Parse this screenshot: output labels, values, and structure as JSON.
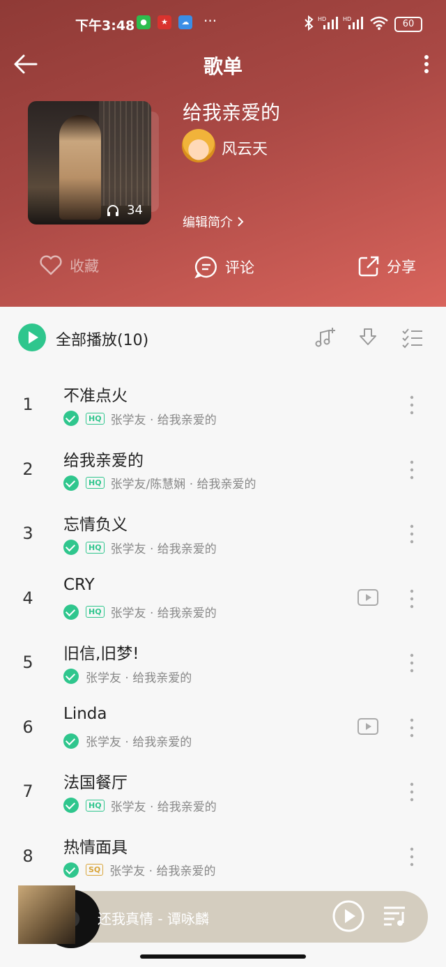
{
  "status_bar": {
    "time": "下午3:48",
    "battery": "60",
    "dots": "···"
  },
  "nav": {
    "title": "歌单"
  },
  "playlist": {
    "title": "给我亲爱的",
    "author": "风云天",
    "play_count": "34",
    "edit_intro": "编辑简介"
  },
  "actions": {
    "collect": "收藏",
    "comment": "评论",
    "share": "分享"
  },
  "list_header": {
    "play_all": "全部播放(10)"
  },
  "songs": [
    {
      "index": "1",
      "title": "不准点火",
      "badge": "HQ",
      "meta": "张学友 · 给我亲爱的",
      "mv": false
    },
    {
      "index": "2",
      "title": "给我亲爱的",
      "badge": "HQ",
      "meta": "张学友/陈慧娴 · 给我亲爱的",
      "mv": false
    },
    {
      "index": "3",
      "title": "忘情负义",
      "badge": "HQ",
      "meta": "张学友 · 给我亲爱的",
      "mv": false
    },
    {
      "index": "4",
      "title": "CRY",
      "badge": "HQ",
      "meta": "张学友 · 给我亲爱的",
      "mv": true
    },
    {
      "index": "5",
      "title": "旧信,旧梦!",
      "badge": "",
      "meta": "张学友 · 给我亲爱的",
      "mv": false
    },
    {
      "index": "6",
      "title": "Linda",
      "badge": "",
      "meta": "张学友 · 给我亲爱的",
      "mv": true
    },
    {
      "index": "7",
      "title": "法国餐厅",
      "badge": "HQ",
      "meta": "张学友 · 给我亲爱的",
      "mv": false
    },
    {
      "index": "8",
      "title": "热情面具",
      "badge": "SQ",
      "meta": "张学友 · 给我亲爱的",
      "mv": false
    }
  ],
  "player": {
    "now_playing": "还我真情 - 谭咏麟"
  },
  "colors": {
    "accent_green": "#2fc68d",
    "header_red": "#a94844",
    "sq_gold": "#d9a53a"
  }
}
